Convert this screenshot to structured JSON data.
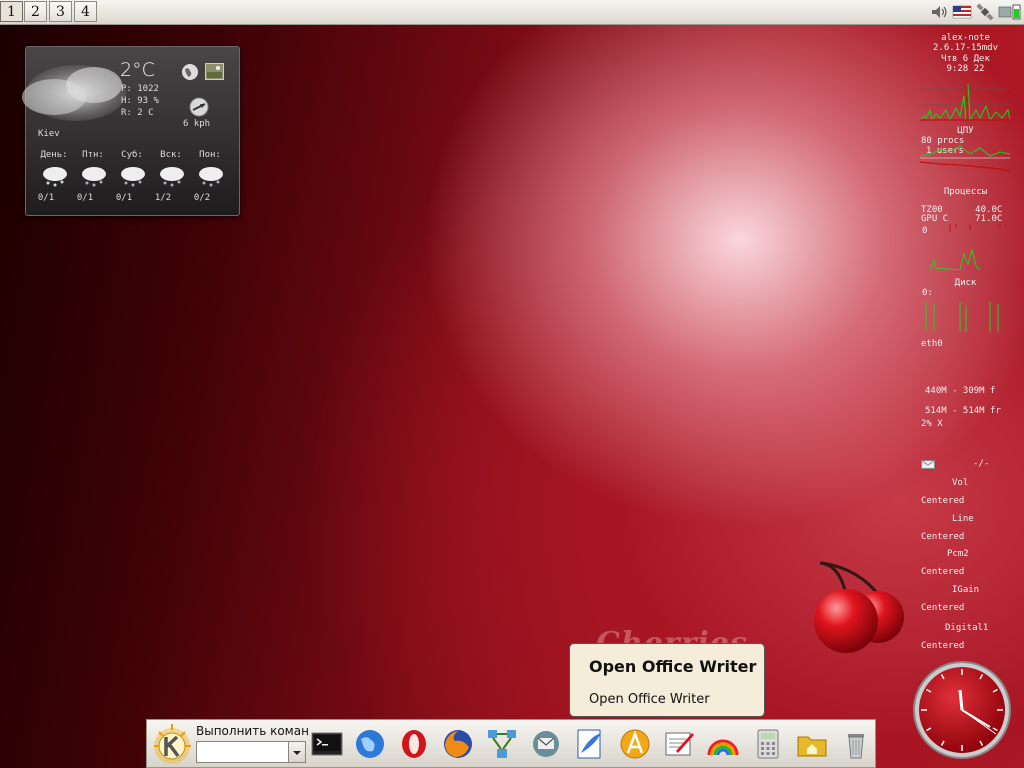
{
  "topbar": {
    "desktops": [
      "1",
      "2",
      "3",
      "4"
    ],
    "active_desktop": "1",
    "tray_icons": [
      "speaker-icon",
      "us-flag-icon",
      "satellite-icon",
      "network-battery-icon"
    ]
  },
  "weather": {
    "temperature": "2°C",
    "pressure": "P: 1022",
    "humidity": "H: 93 %",
    "realfeel": "R: 2 C",
    "city": "Kiev",
    "wind": "6 kph",
    "forecast": [
      {
        "day": "День:",
        "temps": "0/1"
      },
      {
        "day": "Птн:",
        "temps": "0/1"
      },
      {
        "day": "Суб:",
        "temps": "0/1"
      },
      {
        "day": "Вск:",
        "temps": "1/2"
      },
      {
        "day": "Пон:",
        "temps": "0/2"
      }
    ]
  },
  "monitor": {
    "host": "alex-note",
    "kernel": "2.6.17-15mdv",
    "date": "Чтв 6 Дек",
    "time": "9:28 22",
    "cpu_label": "ЦПУ",
    "procs": "80 procs",
    "users": "1 users",
    "processes_label": "Процессы",
    "temp_line1": "TZ00      40.0C",
    "temp_line2": "GPU C     71.0C",
    "temp_line3": "0",
    "disk_label": "Диск",
    "disk_line": "0:",
    "net_label": "eth0",
    "mem_line1": "440M - 309M f",
    "mem_line2": "514M - 514M fr",
    "mem_line3": "2% X",
    "mail_line": "-/-",
    "mixer": [
      {
        "channel": "Vol",
        "mode": "Centered"
      },
      {
        "channel": "Line",
        "mode": "Centered"
      },
      {
        "channel": "Pcm2",
        "mode": "Centered"
      },
      {
        "channel": "IGain",
        "mode": "Centered"
      },
      {
        "channel": "Digital1",
        "mode": "Centered"
      }
    ]
  },
  "wallpaper_text": "Cherries",
  "tooltip": {
    "title": "Open Office Writer",
    "body": "Open Office Writer"
  },
  "panel": {
    "run_label": "Выполнить коман",
    "run_value": "",
    "launchers": [
      "terminal-icon",
      "konqueror-icon",
      "opera-icon",
      "firefox-icon",
      "network-icon",
      "mail-icon",
      "writer-icon",
      "font-icon",
      "notepad-icon",
      "rainbow-icon",
      "calculator-icon",
      "home-folder-icon",
      "trash-icon"
    ]
  }
}
